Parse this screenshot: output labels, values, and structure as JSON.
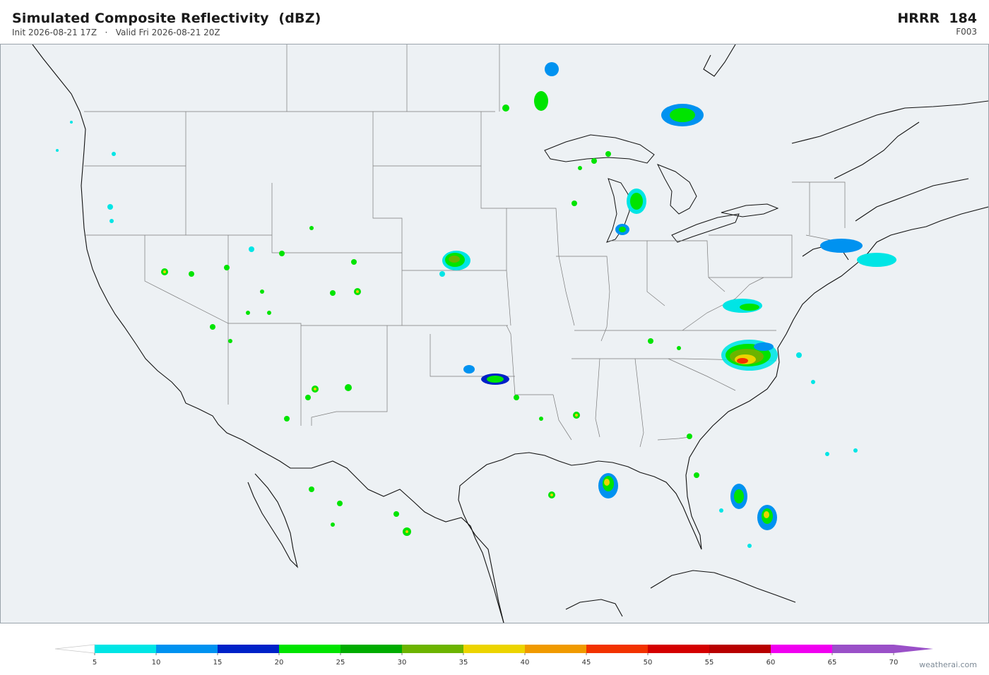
{
  "header": {
    "title": "Simulated Composite Reflectivity  (dBZ)",
    "subtitle": "Init 2026-08-21 17Z   ·   Valid Fri 2026-08-21 20Z",
    "model": "HRRR  184",
    "forecast_hour": "F003"
  },
  "colorbar": {
    "ticks": [
      "5",
      "10",
      "15",
      "20",
      "25",
      "30",
      "35",
      "40",
      "45",
      "50",
      "55",
      "60",
      "65",
      "70"
    ],
    "colors": [
      "#00e5e5",
      "#0092f0",
      "#0022c8",
      "#00e400",
      "#00ac00",
      "#6cb400",
      "#ecd400",
      "#f09a00",
      "#f23200",
      "#d40000",
      "#b80000",
      "#f000f0",
      "#9a50c8"
    ],
    "low_color": "#ffffff",
    "high_color": "#9a50c8"
  },
  "map": {
    "background_color": "#edf1f4",
    "boundary_color": "#000000",
    "state_line_color": "#7a7a7a"
  },
  "watermark": "weatherai.com"
}
